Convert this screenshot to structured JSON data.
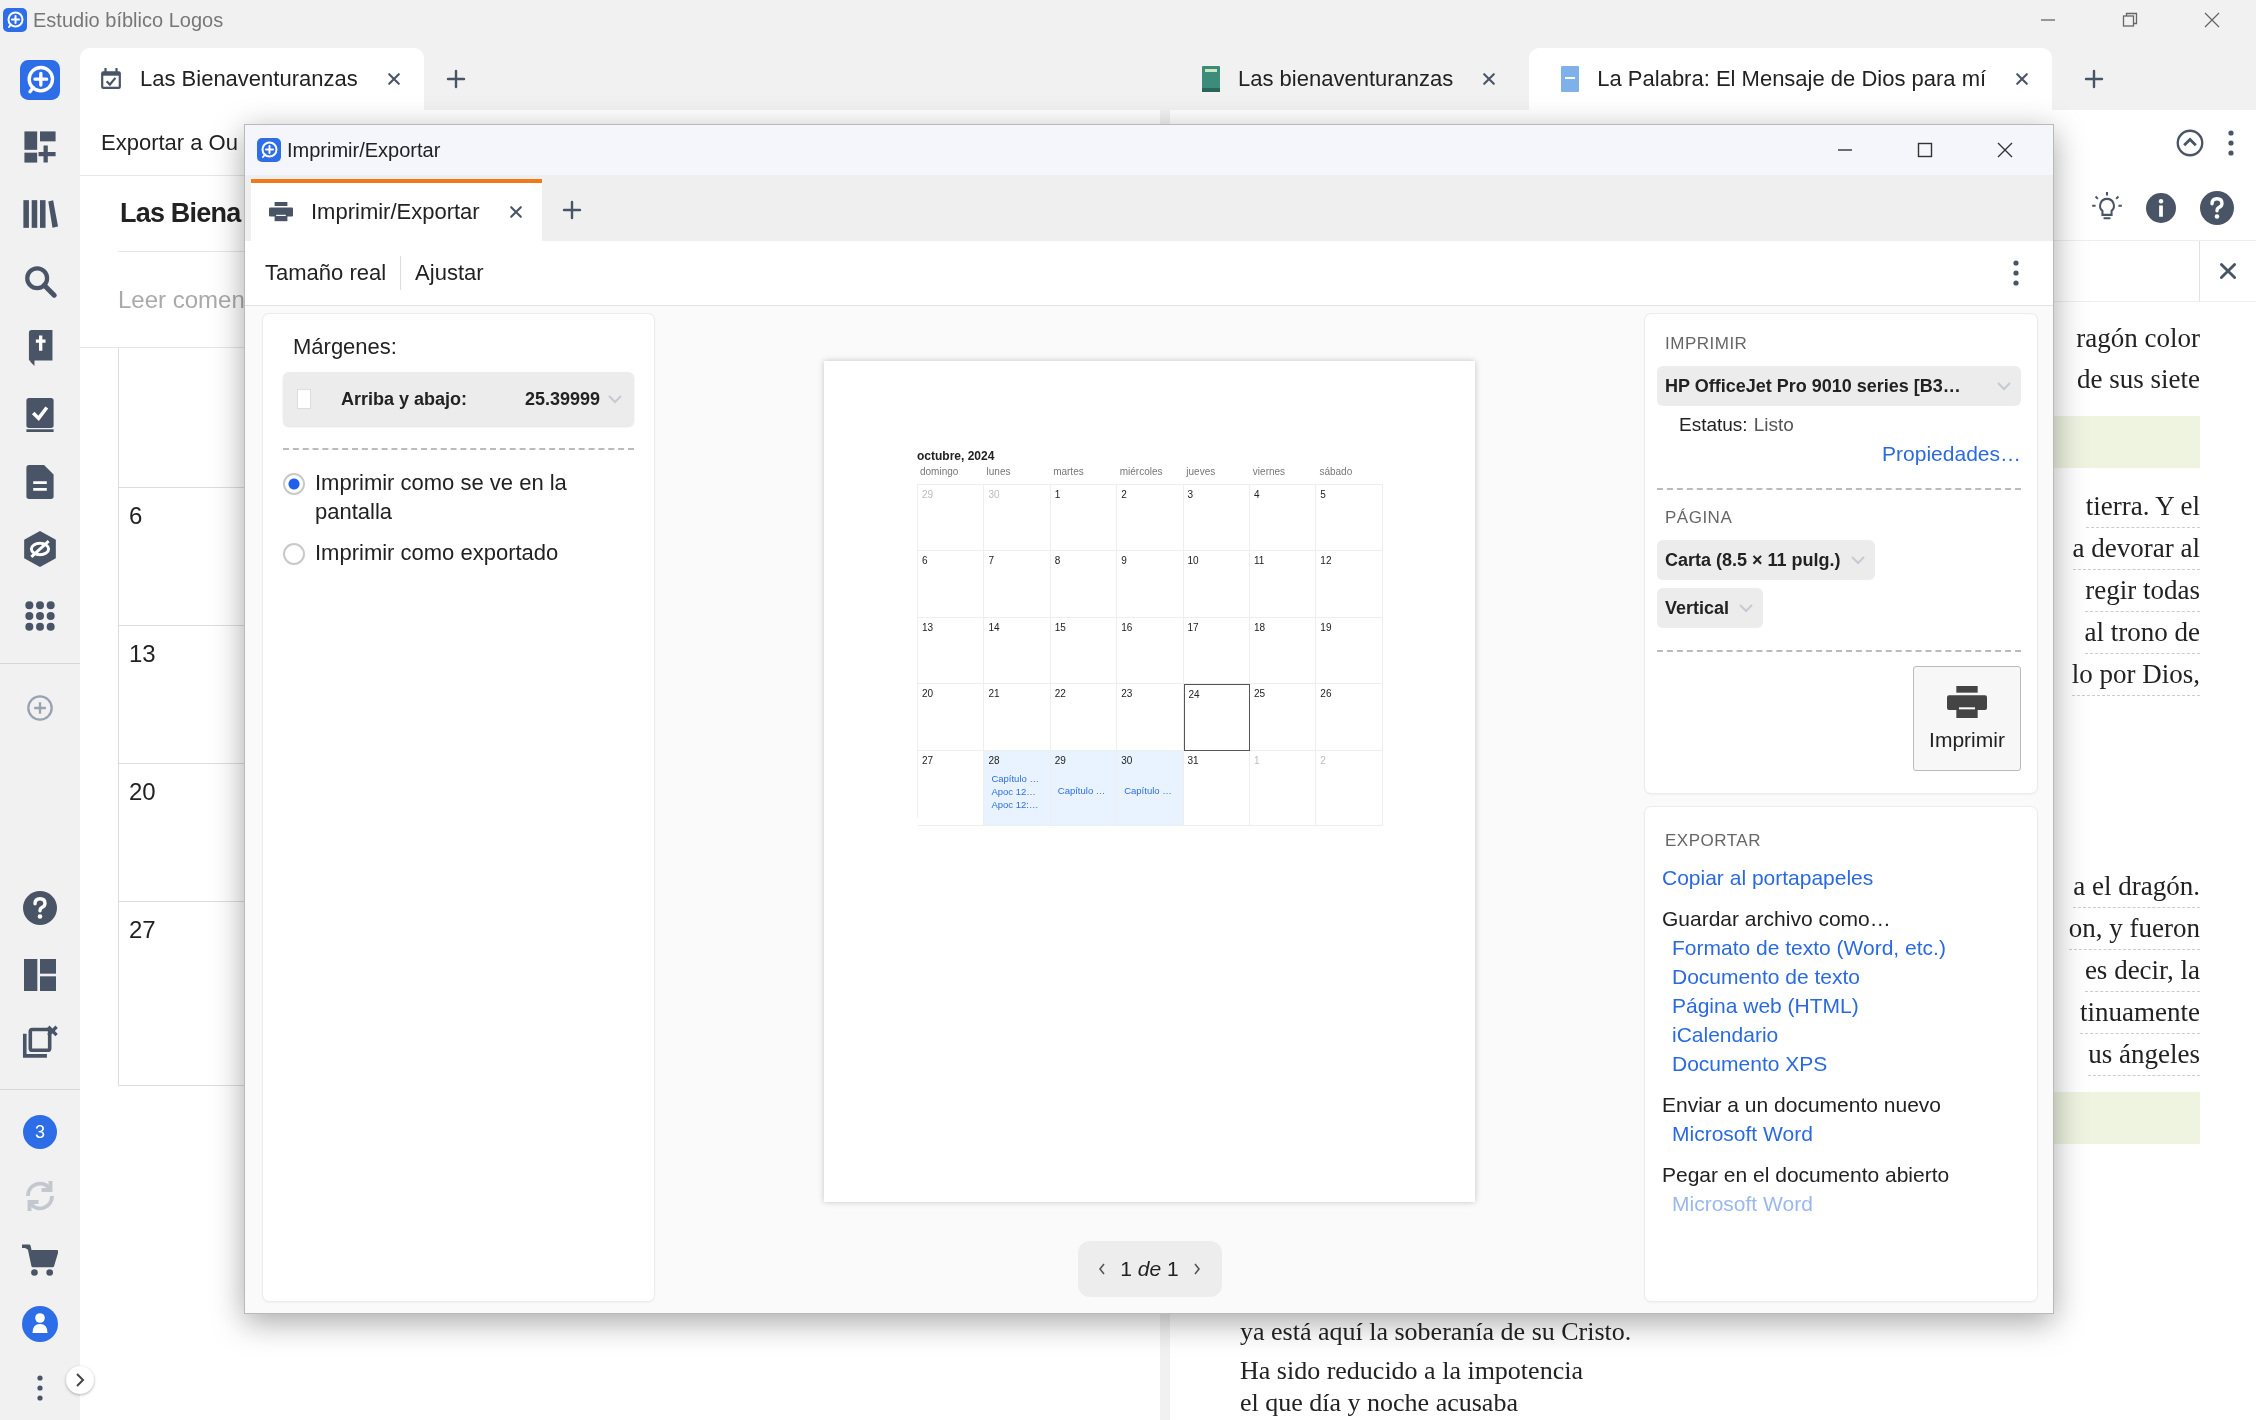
{
  "app": {
    "title": "Estudio bíblico Logos"
  },
  "sidebar": {
    "top": [
      {
        "kind": "logo"
      },
      {
        "kind": "dashboard"
      },
      {
        "kind": "library"
      },
      {
        "kind": "search"
      },
      {
        "kind": "bible"
      },
      {
        "kind": "checklist"
      },
      {
        "kind": "document"
      },
      {
        "kind": "atlas"
      },
      {
        "kind": "apps"
      }
    ],
    "add": [
      {
        "kind": "add"
      }
    ],
    "middle": [
      {
        "kind": "help"
      },
      {
        "kind": "layout"
      },
      {
        "kind": "close-panels"
      }
    ],
    "bottom": [
      {
        "kind": "notifications",
        "badge": "3"
      },
      {
        "kind": "sync"
      },
      {
        "kind": "cart"
      },
      {
        "kind": "account"
      },
      {
        "kind": "more"
      }
    ]
  },
  "tabs_left": [
    {
      "label": "Las Bienaventuranzas",
      "kind": "calendar",
      "selected": true
    }
  ],
  "tabs_right": [
    {
      "label": "Las bienaventuranzas",
      "kind": "book",
      "selected": false
    },
    {
      "label": "La Palabra: El Mensaje de Dios para mí",
      "kind": "doc",
      "selected": true
    }
  ],
  "left_panel": {
    "toolbar_text": "Exportar a Ou",
    "title": "Las Biena",
    "subtitle": "Leer comen",
    "days": [
      "6",
      "13",
      "20",
      "27"
    ]
  },
  "reader": {
    "blocks": [
      {
        "kind": "text",
        "lines": [
          "ragón color",
          "de sus siete"
        ]
      },
      {
        "kind": "band"
      },
      {
        "kind": "text",
        "lines": [
          "tierra. Y el",
          "a devorar al",
          "regir todas",
          "al trono de",
          "lo por Dios,"
        ]
      },
      {
        "kind": "text",
        "lines": [
          "a el dragón.",
          "on, y fueron",
          "es decir, la",
          "tinuamente",
          "us ángeles"
        ]
      },
      {
        "kind": "band"
      }
    ],
    "below": [
      "ya está aquí la soberanía de su Cristo.",
      "Ha sido reducido a la impotencia",
      "el que día y noche acusaba"
    ]
  },
  "dialog": {
    "title": "Imprimir/Exportar",
    "tabs": [
      {
        "label": "Imprimir/Exportar",
        "selected": true
      }
    ],
    "toolbar": [
      "Tamaño real",
      "Ajustar"
    ],
    "margins": {
      "label": "Márgenes:",
      "checked": false,
      "field_label": "Arriba y abajo:",
      "value": "25.39999"
    },
    "print_modes": [
      {
        "label": "Imprimir como se ve en la pantalla",
        "selected": true
      },
      {
        "label": "Imprimir como exportado",
        "selected": false
      }
    ],
    "calendar": {
      "title": "octubre, 2024",
      "weekdays": [
        "domingo",
        "lunes",
        "martes",
        "miércoles",
        "jueves",
        "viernes",
        "sábado"
      ],
      "weeks": [
        [
          {
            "day": "29",
            "muted": true,
            "today": false
          },
          {
            "day": "30",
            "muted": true,
            "today": false
          },
          {
            "day": "1",
            "muted": false,
            "today": false
          },
          {
            "day": "2",
            "muted": false,
            "today": false
          },
          {
            "day": "3",
            "muted": false,
            "today": false
          },
          {
            "day": "4",
            "muted": false,
            "today": false
          },
          {
            "day": "5",
            "muted": false,
            "today": false
          }
        ],
        [
          {
            "day": "6",
            "muted": false,
            "today": false
          },
          {
            "day": "7",
            "muted": false,
            "today": false
          },
          {
            "day": "8",
            "muted": false,
            "today": false
          },
          {
            "day": "9",
            "muted": false,
            "today": false
          },
          {
            "day": "10",
            "muted": false,
            "today": false
          },
          {
            "day": "11",
            "muted": false,
            "today": false
          },
          {
            "day": "12",
            "muted": false,
            "today": false
          }
        ],
        [
          {
            "day": "13",
            "muted": false,
            "today": false
          },
          {
            "day": "14",
            "muted": false,
            "today": false
          },
          {
            "day": "15",
            "muted": false,
            "today": false
          },
          {
            "day": "16",
            "muted": false,
            "today": false
          },
          {
            "day": "17",
            "muted": false,
            "today": false
          },
          {
            "day": "18",
            "muted": false,
            "today": false
          },
          {
            "day": "19",
            "muted": false,
            "today": false
          }
        ],
        [
          {
            "day": "20",
            "muted": false,
            "today": false
          },
          {
            "day": "21",
            "muted": false,
            "today": false
          },
          {
            "day": "22",
            "muted": false,
            "today": false
          },
          {
            "day": "23",
            "muted": false,
            "today": false
          },
          {
            "day": "24",
            "muted": false,
            "today": true
          },
          {
            "day": "25",
            "muted": false,
            "today": false
          },
          {
            "day": "26",
            "muted": false,
            "today": false
          }
        ],
        [
          {
            "day": "27",
            "muted": false,
            "today": false
          },
          {
            "day": "28",
            "muted": false,
            "today": false,
            "events": [
              "Capítulo …",
              "Apoc 12…",
              "Apoc 12:…"
            ]
          },
          {
            "day": "29",
            "muted": false,
            "today": false,
            "events": [
              "Capítulo …"
            ]
          },
          {
            "day": "30",
            "muted": false,
            "today": false,
            "events": [
              "Capítulo …"
            ]
          },
          {
            "day": "31",
            "muted": false,
            "today": false
          },
          {
            "day": "1",
            "muted": true,
            "today": false
          },
          {
            "day": "2",
            "muted": true,
            "today": false
          }
        ]
      ]
    },
    "pager": {
      "current": "1",
      "separator": "de",
      "total": "1"
    },
    "print": {
      "heading": "IMPRIMIR",
      "printer": "HP OfficeJet Pro 9010 series [B3…",
      "status_label": "Estatus:",
      "status": "Listo",
      "properties": "Propiedades…",
      "page_heading": "PÁGINA",
      "paper": "Carta (8.5 × 11 pulg.)",
      "orientation": "Vertical",
      "button": "Imprimir"
    },
    "export": {
      "heading": "EXPORTAR",
      "groups": [
        {
          "links": [
            {
              "label": "Copiar al portapapeles",
              "disabled": false
            }
          ]
        },
        {
          "title": "Guardar archivo como…",
          "links": [
            {
              "label": "Formato de texto (Word, etc.)",
              "disabled": false
            },
            {
              "label": "Documento de texto",
              "disabled": false
            },
            {
              "label": "Página web (HTML)",
              "disabled": false
            },
            {
              "label": "iCalendario",
              "disabled": false
            },
            {
              "label": "Documento XPS",
              "disabled": false
            }
          ]
        },
        {
          "title": "Enviar a un documento nuevo",
          "links": [
            {
              "label": "Microsoft Word",
              "disabled": false
            }
          ]
        },
        {
          "title": "Pegar en el documento abierto",
          "links": [
            {
              "label": "Microsoft Word",
              "disabled": true
            }
          ]
        }
      ]
    }
  }
}
